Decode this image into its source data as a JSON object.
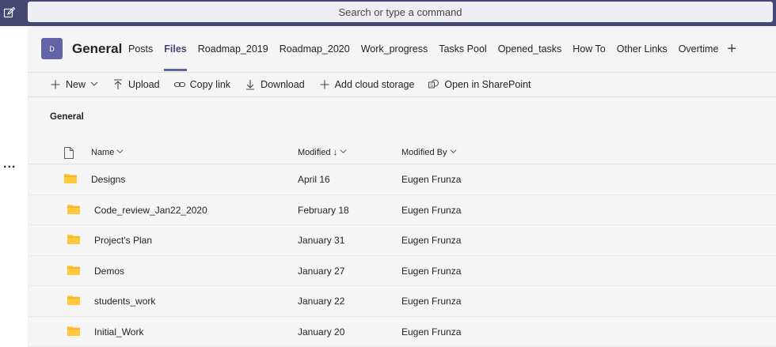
{
  "topbar": {
    "search_placeholder": "Search or type a command",
    "compose_icon": "compose-icon"
  },
  "leftrail": {
    "more": "..."
  },
  "channel": {
    "avatar_letter": "D",
    "name": "General",
    "tabs": [
      {
        "label": "Posts",
        "active": false
      },
      {
        "label": "Files",
        "active": true
      },
      {
        "label": "Roadmap_2019",
        "active": false
      },
      {
        "label": "Roadmap_2020",
        "active": false
      },
      {
        "label": "Work_progress",
        "active": false
      },
      {
        "label": "Tasks Pool",
        "active": false
      },
      {
        "label": "Opened_tasks",
        "active": false
      },
      {
        "label": "How To",
        "active": false
      },
      {
        "label": "Other Links",
        "active": false
      },
      {
        "label": "Overtime",
        "active": false
      }
    ],
    "add_tab": "+"
  },
  "toolbar": {
    "new_label": "New",
    "upload_label": "Upload",
    "copy_link_label": "Copy link",
    "download_label": "Download",
    "add_cloud_label": "Add cloud storage",
    "open_sharepoint_label": "Open in SharePoint"
  },
  "folder_title": "General",
  "table": {
    "headers": {
      "name": "Name",
      "modified": "Modified ↓",
      "modified_by": "Modified By"
    },
    "rows": [
      {
        "name": "Designs",
        "modified": "April 16",
        "modified_by": "Eugen Frunza"
      },
      {
        "name": "Code_review_Jan22_2020",
        "modified": "February 18",
        "modified_by": "Eugen Frunza"
      },
      {
        "name": "Project's Plan",
        "modified": "January 31",
        "modified_by": "Eugen Frunza"
      },
      {
        "name": "Demos",
        "modified": "January 27",
        "modified_by": "Eugen Frunza"
      },
      {
        "name": "students_work",
        "modified": "January 22",
        "modified_by": "Eugen Frunza"
      },
      {
        "name": "Initial_Work",
        "modified": "January 20",
        "modified_by": "Eugen Frunza"
      }
    ]
  },
  "colors": {
    "topbar": "#464775",
    "accent": "#6264a7",
    "folder": "#ffc83d"
  }
}
